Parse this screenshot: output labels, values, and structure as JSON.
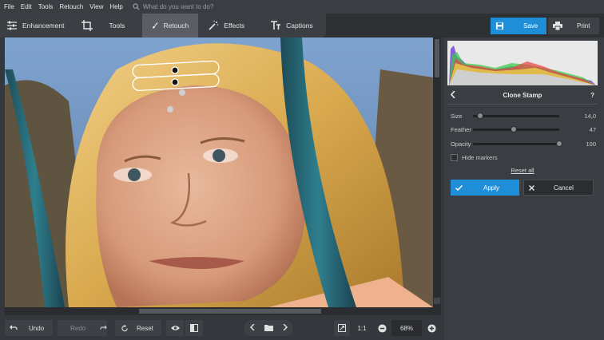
{
  "menu": [
    "File",
    "Edit",
    "Tools",
    "Retouch",
    "View",
    "Help"
  ],
  "search_placeholder": "What do you want to do?",
  "tabs": [
    {
      "label": "Enhancement",
      "icon": "sliders-icon"
    },
    {
      "label": "Tools",
      "icon": "crop-icon"
    },
    {
      "label": "Retouch",
      "icon": "brush-icon",
      "active": true
    },
    {
      "label": "Effects",
      "icon": "magic-wand-icon"
    },
    {
      "label": "Captions",
      "icon": "text-icon"
    }
  ],
  "save_label": "Save",
  "print_label": "Print",
  "panel": {
    "title": "Clone Stamp",
    "help": "?",
    "sliders": [
      {
        "label": "Size",
        "value": "14,0",
        "level": 0.08
      },
      {
        "label": "Feather",
        "value": "47",
        "level": 0.47
      },
      {
        "label": "Opacity",
        "value": "100",
        "level": 1.0
      }
    ],
    "hide_markers": "Hide markers",
    "reset_all": "Reset all",
    "apply": "Apply",
    "cancel": "Cancel"
  },
  "bottom": {
    "undo": "Undo",
    "redo": "Redo",
    "reset": "Reset",
    "one_to_one": "1:1",
    "zoom": "68%"
  },
  "colors": {
    "accent": "#1e8ed9",
    "bg": "#34373b",
    "panel": "#3a3d41"
  }
}
